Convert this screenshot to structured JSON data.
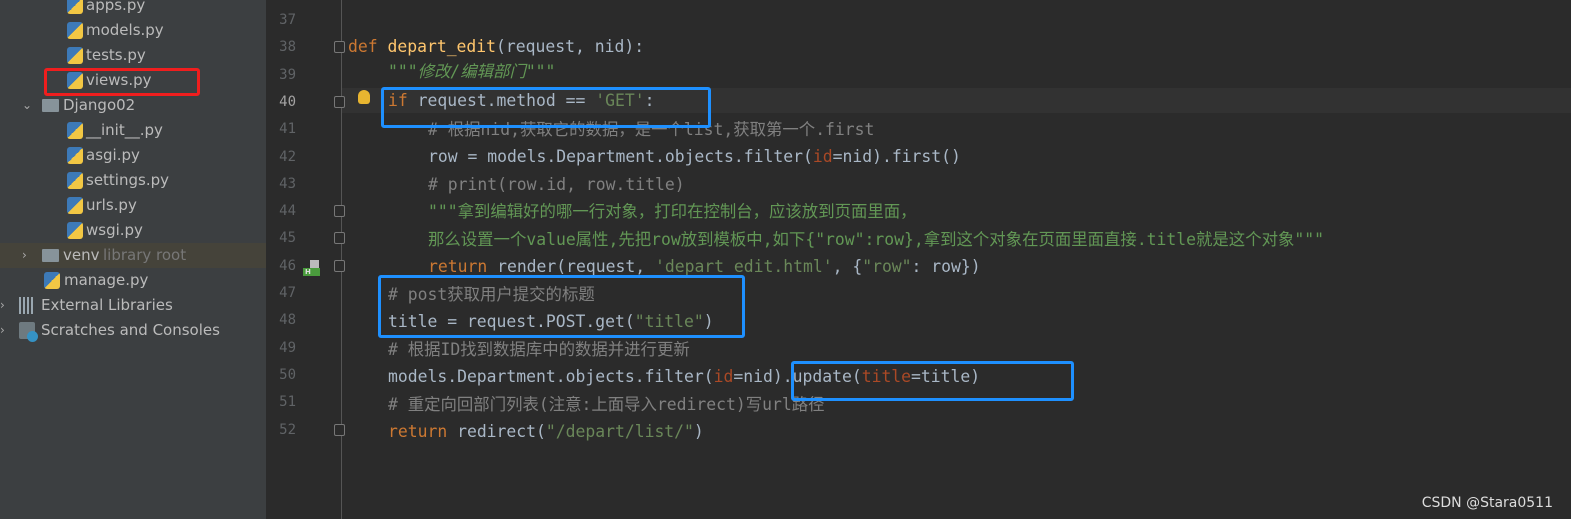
{
  "sidebar": {
    "items": [
      {
        "label": "apps.py",
        "type": "py"
      },
      {
        "label": "models.py",
        "type": "py"
      },
      {
        "label": "tests.py",
        "type": "py"
      },
      {
        "label": "views.py",
        "type": "py"
      },
      {
        "label": "Django02",
        "type": "folder"
      },
      {
        "label": "__init__.py",
        "type": "py"
      },
      {
        "label": "asgi.py",
        "type": "py"
      },
      {
        "label": "settings.py",
        "type": "py"
      },
      {
        "label": "urls.py",
        "type": "py"
      },
      {
        "label": "wsgi.py",
        "type": "py"
      },
      {
        "label": "venv",
        "hint": "library root",
        "type": "folder"
      },
      {
        "label": "manage.py",
        "type": "py"
      },
      {
        "label": "External Libraries",
        "type": "libraries"
      },
      {
        "label": "Scratches and Consoles",
        "type": "scratches"
      }
    ]
  },
  "editor": {
    "line_numbers": [
      "37",
      "38",
      "39",
      "40",
      "41",
      "42",
      "43",
      "44",
      "45",
      "46",
      "47",
      "48",
      "49",
      "50",
      "51",
      "52"
    ],
    "current_line": "40",
    "lines": {
      "l38": [
        "def ",
        "depart_edit",
        "(request, nid):"
      ],
      "l39": "\"\"\"修改/编辑部门\"\"\"",
      "l40": [
        "if ",
        "request.method == ",
        "'GET'",
        ":"
      ],
      "l41": "# 根据nid,获取它的数据，是一个list,获取第一个.first",
      "l42": [
        "row = models.Department.objects.filter(",
        "id",
        "=nid).first()"
      ],
      "l43": "# print(row.id, row.title)",
      "l44": "\"\"\"拿到编辑好的哪一行对象，打印在控制台，应该放到页面里面，",
      "l45": "那么设置一个value属性,先把row放到模板中,如下{\"row\":row},拿到这个对象在页面里面直接.title就是这个对象\"\"\"",
      "l46": [
        "return ",
        "render(request, ",
        "'depart_edit.html'",
        ", {",
        "\"row\"",
        ": row})"
      ],
      "l47": "# post获取用户提交的标题",
      "l48": [
        "title = request.POST.get(",
        "\"title\"",
        ")"
      ],
      "l49": "# 根据ID找到数据库中的数据并进行更新",
      "l50": [
        "models.Department.objects.filter(",
        "id",
        "=nid).update(",
        "title",
        "=title)"
      ],
      "l51": "# 重定向回部门列表(注意:上面导入redirect)写url路径",
      "l52": [
        "return ",
        "redirect(",
        "\"/depart/list/\"",
        ")"
      ]
    }
  },
  "colors": {
    "keyword": "#cc7832",
    "function": "#ffc66d",
    "string": "#6a8759",
    "comment": "#808080",
    "param": "#aa4926",
    "highlight_box": "#1e90ff",
    "red_box": "#f01e1e"
  },
  "watermark": "CSDN @Stara0511"
}
